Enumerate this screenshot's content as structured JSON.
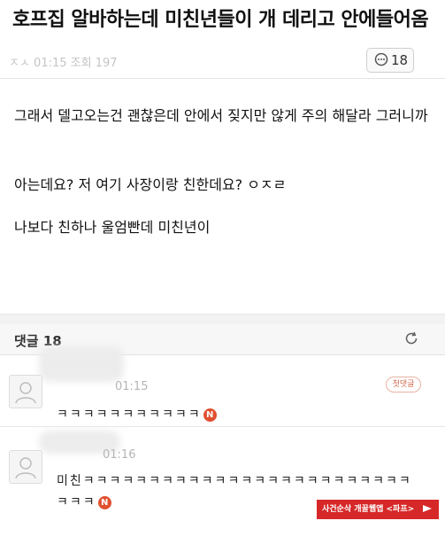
{
  "title": "호프집 알바하는데 미친년들이 개 데리고 안에들어옴",
  "meta": {
    "text": "ㅈㅅ  01:15  조회 197",
    "comment_count": "18"
  },
  "post": {
    "paragraph1": "그래서 델고오는건 괜찮은데 안에서 짖지만 않게 주의 해달라 그러니까",
    "paragraph2": "아는데요? 저 여기 사장이랑 친한데요? ㅇㅈㄹ",
    "paragraph3": "나보다 친하나 울엄빤데 미친년이"
  },
  "comments_header": {
    "label": "댓글 18"
  },
  "comments": [
    {
      "time": "01:15",
      "text": "ㅋㅋㅋㅋㅋㅋㅋㅋㅋㅋㅋ",
      "new_badge": "N",
      "first_reply_badge": "첫댓글"
    },
    {
      "time": "01:16",
      "text_line1": "미친ㅋㅋㅋㅋㅋㅋㅋㅋㅋㅋㅋㅋㅋㅋㅋㅋㅋㅋㅋㅋㅋㅋㅋㅋㅋ",
      "text_line2": "ㅋㅋㅋ",
      "new_badge": "N"
    }
  ],
  "watermark": {
    "text": "사건순삭 개꿀웹앱 <파프>"
  },
  "colors": {
    "badge_red": "#e0502f",
    "watermark_red": "#d62828"
  },
  "icons": {
    "comment": "speech-bubble-icon",
    "refresh": "refresh-icon",
    "avatar": "user-silhouette-icon"
  }
}
